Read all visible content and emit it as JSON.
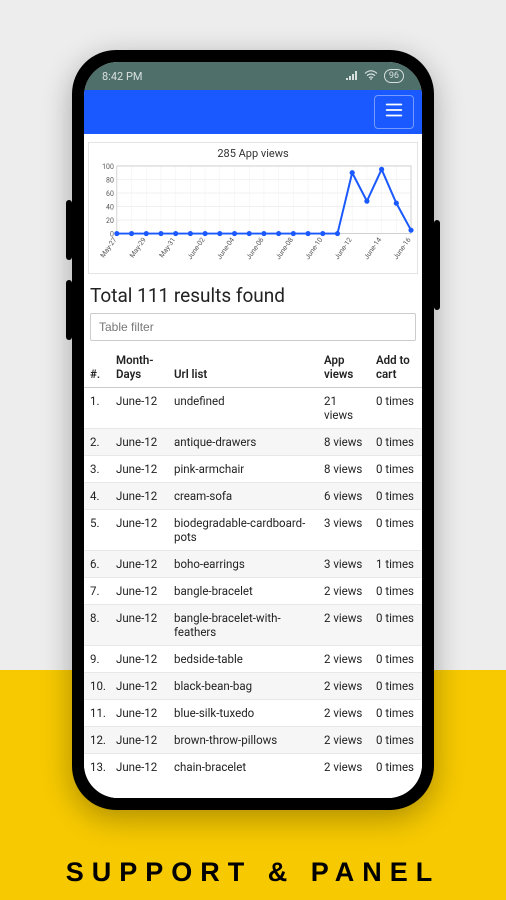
{
  "status": {
    "time": "8:42 PM",
    "battery": "96"
  },
  "chart": {
    "title": "285 App views"
  },
  "chart_data": {
    "type": "line",
    "title": "285 App views",
    "xlabel": "",
    "ylabel": "",
    "ylim": [
      0,
      100
    ],
    "y_ticks": [
      0,
      20,
      40,
      60,
      80,
      100
    ],
    "categories": [
      "May-27",
      "May-29",
      "May-31",
      "June-02",
      "June-04",
      "June-06",
      "June-08",
      "June-10",
      "June-12",
      "June-14",
      "June-16"
    ],
    "series": [
      {
        "name": "App views",
        "color": "#1a59ff",
        "x": [
          "May-27",
          "May-28",
          "May-29",
          "May-30",
          "May-31",
          "June-01",
          "June-02",
          "June-03",
          "June-04",
          "June-05",
          "June-06",
          "June-07",
          "June-08",
          "June-09",
          "June-10",
          "June-11",
          "June-12",
          "June-13",
          "June-14",
          "June-15",
          "June-16"
        ],
        "values": [
          0,
          0,
          0,
          0,
          0,
          0,
          0,
          0,
          0,
          0,
          0,
          0,
          0,
          0,
          0,
          0,
          90,
          48,
          95,
          45,
          5
        ]
      }
    ]
  },
  "results": {
    "title": "Total 111 results found",
    "filter_placeholder": "Table filter"
  },
  "table": {
    "headers": {
      "num": "#.",
      "month": "Month-Days",
      "url": "Url list",
      "views": "App views",
      "cart": "Add to cart"
    },
    "rows": [
      {
        "n": "1.",
        "month": "June-12",
        "url": "undefined",
        "views": "21 views",
        "cart": "0 times"
      },
      {
        "n": "2.",
        "month": "June-12",
        "url": "antique-drawers",
        "views": "8 views",
        "cart": "0 times"
      },
      {
        "n": "3.",
        "month": "June-12",
        "url": "pink-armchair",
        "views": "8 views",
        "cart": "0 times"
      },
      {
        "n": "4.",
        "month": "June-12",
        "url": "cream-sofa",
        "views": "6 views",
        "cart": "0 times"
      },
      {
        "n": "5.",
        "month": "June-12",
        "url": "biodegradable-cardboard-pots",
        "views": "3 views",
        "cart": "0 times"
      },
      {
        "n": "6.",
        "month": "June-12",
        "url": "boho-earrings",
        "views": "3 views",
        "cart": "1 times"
      },
      {
        "n": "7.",
        "month": "June-12",
        "url": "bangle-bracelet",
        "views": "2 views",
        "cart": "0 times"
      },
      {
        "n": "8.",
        "month": "June-12",
        "url": "bangle-bracelet-with-feathers",
        "views": "2 views",
        "cart": "0 times"
      },
      {
        "n": "9.",
        "month": "June-12",
        "url": "bedside-table",
        "views": "2 views",
        "cart": "0 times"
      },
      {
        "n": "10.",
        "month": "June-12",
        "url": "black-bean-bag",
        "views": "2 views",
        "cart": "0 times"
      },
      {
        "n": "11.",
        "month": "June-12",
        "url": "blue-silk-tuxedo",
        "views": "2 views",
        "cart": "0 times"
      },
      {
        "n": "12.",
        "month": "June-12",
        "url": "brown-throw-pillows",
        "views": "2 views",
        "cart": "0 times"
      },
      {
        "n": "13.",
        "month": "June-12",
        "url": "chain-bracelet",
        "views": "2 views",
        "cart": "0 times"
      }
    ]
  },
  "footer": "SUPPORT & PANEL"
}
